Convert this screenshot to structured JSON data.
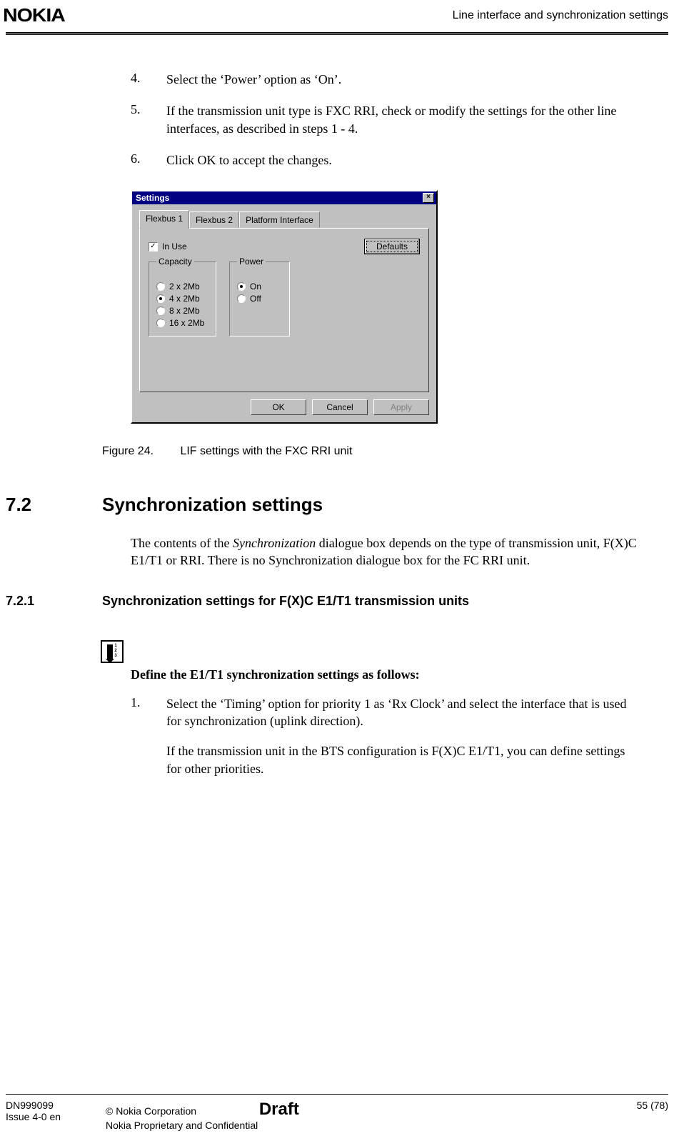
{
  "header": {
    "logo": "NOKIA",
    "title": "Line interface and synchronization settings"
  },
  "steps_a": [
    {
      "num": "4.",
      "text": "Select the ‘Power’ option as ‘On’."
    },
    {
      "num": "5.",
      "text": "If the transmission unit type is FXC RRI, check or modify the settings for the other line interfaces, as described in steps 1 - 4."
    },
    {
      "num": "6.",
      "text": "Click OK to accept the changes."
    }
  ],
  "dialog": {
    "title": "Settings",
    "close": "×",
    "tabs": {
      "t1": "Flexbus 1",
      "t2": "Flexbus 2",
      "t3": "Platform Interface"
    },
    "in_use": "In Use",
    "check_mark": "✓",
    "defaults_btn": "Defaults",
    "capacity": {
      "legend": "Capacity",
      "opts": [
        "2 x 2Mb",
        "4 x 2Mb",
        "8 x 2Mb",
        "16 x 2Mb"
      ],
      "selected": 1
    },
    "power": {
      "legend": "Power",
      "opts": [
        "On",
        "Off"
      ],
      "selected": 0
    },
    "ok": "OK",
    "cancel": "Cancel",
    "apply": "Apply"
  },
  "figure": {
    "label": "Figure 24.",
    "caption": "LIF settings with the FXC RRI unit"
  },
  "section": {
    "num": "7.2",
    "title": "Synchronization settings",
    "para_a": "The contents of the ",
    "para_em": "Synchronization",
    "para_b": " dialogue box depends on the type of transmission unit, F(X)C E1/T1 or RRI. There is no Synchronization dialogue box for the FC RRI unit."
  },
  "subsection": {
    "num": "7.2.1",
    "title": "Synchronization settings for F(X)C E1/T1 transmission units"
  },
  "proc_icon_nums": "1\n2\n3",
  "proc_title": "Define the E1/T1 synchronization settings as follows:",
  "steps_b": [
    {
      "num": "1.",
      "text": "Select the ‘Timing’ option for priority 1 as ‘Rx Clock’ and select the interface that is used for synchronization (uplink direction).",
      "text2": "If the transmission unit in the BTS configuration is F(X)C E1/T1, you can define settings for other priorities."
    }
  ],
  "footer": {
    "dn": "DN999099",
    "issue": "Issue 4-0 en",
    "copyright": "© Nokia Corporation",
    "conf": "Nokia Proprietary and Confidential",
    "draft": "Draft",
    "page": "55 (78)"
  }
}
